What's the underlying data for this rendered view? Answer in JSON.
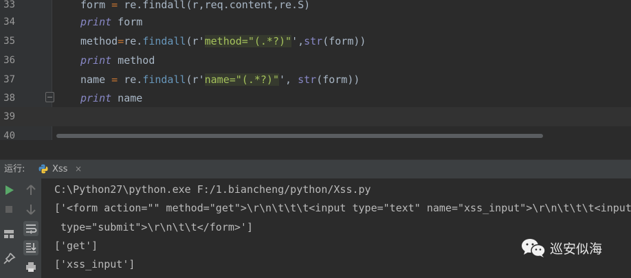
{
  "editor": {
    "lines": [
      {
        "num": "33"
      },
      {
        "num": "34"
      },
      {
        "num": "35"
      },
      {
        "num": "36"
      },
      {
        "num": "37"
      },
      {
        "num": "38"
      },
      {
        "num": "39"
      },
      {
        "num": "40"
      }
    ],
    "code": {
      "l33_var": "form",
      "l33_eq": " = ",
      "l33_call": "re.findall(r,req.content,re.S)",
      "l34_kw": "print",
      "l34_arg": " form",
      "l35_var": "method",
      "l35_eq": "=",
      "l35_re": "re.",
      "l35_fn": "findall",
      "l35_p": "(r'",
      "l35_str": "method=\"(.*?)\"",
      "l35_q": "',",
      "l35_b": "str",
      "l35_end": "(form))",
      "l36_kw": "print",
      "l36_arg": " method",
      "l37_var": "name",
      "l37_eq": " = ",
      "l37_re": "re.",
      "l37_fn": "findall",
      "l37_p": "(r'",
      "l37_str": "name=\"(.*?)\"",
      "l37_q": "', ",
      "l37_b": "str",
      "l37_end": "(form))",
      "l38_kw": "print",
      "l38_arg": " name"
    }
  },
  "run_panel": {
    "label": "运行:",
    "tab_label": "Xss",
    "tab_close": "×",
    "output": [
      "C:\\Python27\\python.exe F:/1.biancheng/python/Xss.py",
      "['<form action=\"\" method=\"get\">\\r\\n\\t\\t\\t<input type=\"text\" name=\"xss_input\">\\r\\n\\t\\t\\t<input",
      " type=\"submit\">\\r\\n\\t\\t</form>']",
      "['get']",
      "['xss_input']"
    ]
  },
  "watermark": {
    "text": "巡安似海",
    "icon": "wechat-icon"
  },
  "colors": {
    "background": "#2b2b2b",
    "keyword": "#8888c6",
    "string": "#a5c25c",
    "function": "#6897bb",
    "run_green": "#59a869"
  }
}
